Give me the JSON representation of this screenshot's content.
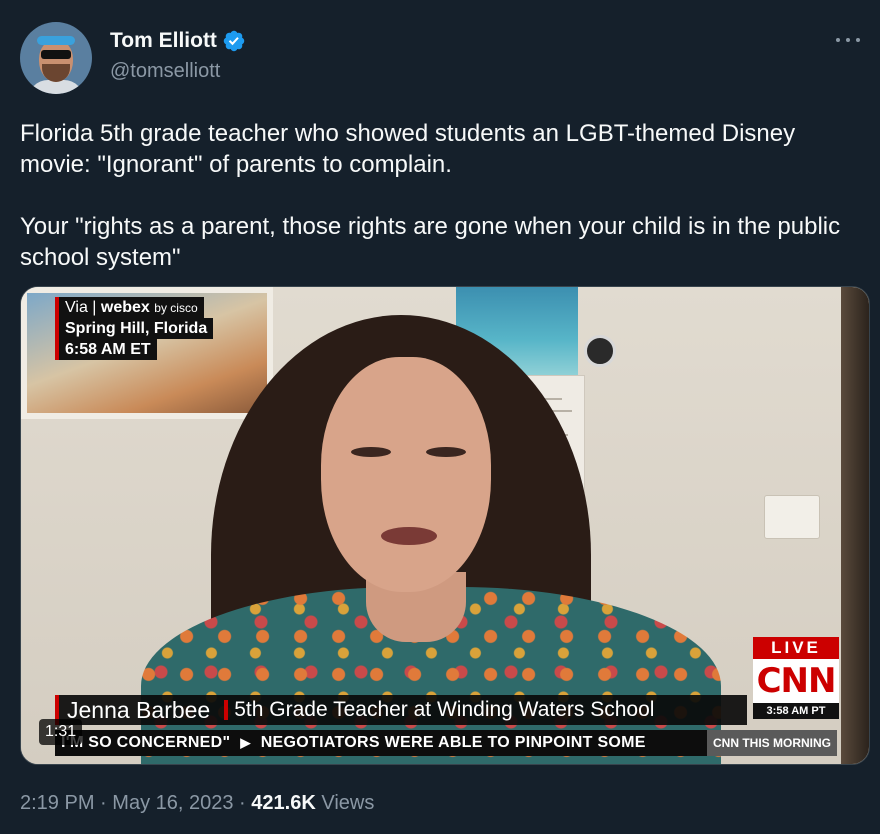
{
  "author": {
    "display_name": "Tom Elliott",
    "handle": "@tomselliott",
    "verified": true,
    "avatar_icon": "profile-photo",
    "more_icon": "more-horizontal-icon"
  },
  "tweet": {
    "paragraphs": [
      "Florida 5th grade teacher who showed students an LGBT-themed Disney movie: \"Ignorant\" of parents to complain.",
      "Your \"rights as a parent, those rights are gone when your child is in the public school system\""
    ]
  },
  "video": {
    "duration": "1:31",
    "via_label": "Via",
    "via_brand": "webex",
    "via_by": "by cisco",
    "location": "Spring Hill, Florida",
    "local_time": "6:58 AM ET",
    "live_label": "LIVE",
    "network": "CNN",
    "network_time": "3:58 AM PT",
    "lower_third_name": "Jenna Barbee",
    "lower_third_title": "5th Grade Teacher at Winding Waters School",
    "ticker_left": "I'M SO CONCERNED\"",
    "ticker_right": "NEGOTIATORS WERE ABLE TO PINPOINT SOME",
    "show_name": "CNN THIS MORNING"
  },
  "meta": {
    "time": "2:19 PM",
    "date": "May 16, 2023",
    "views_count": "421.6K",
    "views_label": "Views",
    "separator": "·"
  },
  "colors": {
    "background": "#15202b",
    "text_primary": "#f7f9f9",
    "text_secondary": "#8b98a5",
    "verified_blue": "#1d9bf0",
    "cnn_red": "#cc0000"
  }
}
